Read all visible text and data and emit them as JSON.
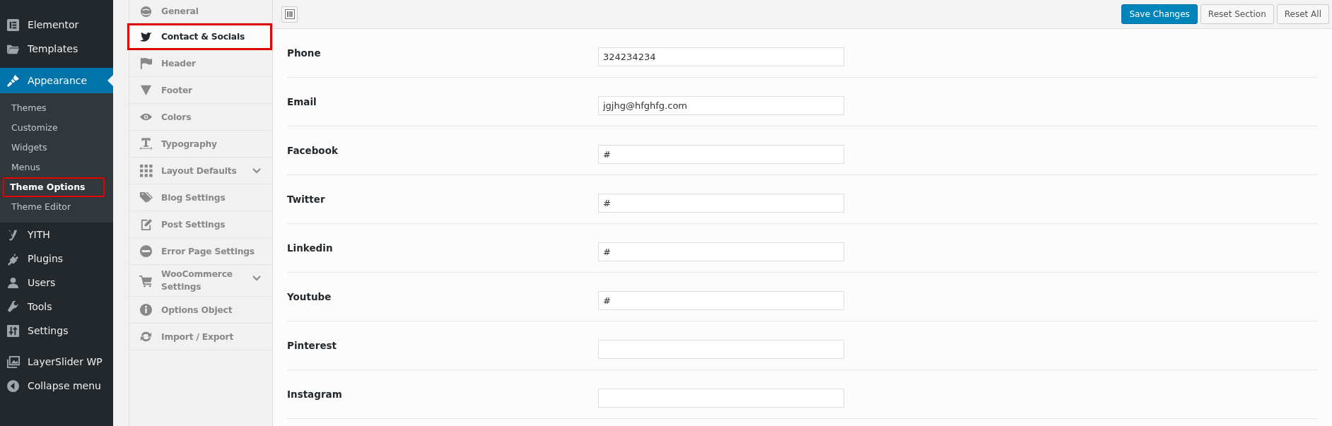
{
  "admin_menu": {
    "groups": [
      {
        "items": [
          {
            "label": "Elementor",
            "current": false
          },
          {
            "label": "Templates",
            "current": false
          }
        ]
      },
      {
        "items": [
          {
            "label": "Appearance",
            "current": true,
            "submenu": [
              {
                "label": "Themes",
                "selected": false,
                "highlighted": false
              },
              {
                "label": "Customize",
                "selected": false,
                "highlighted": false
              },
              {
                "label": "Widgets",
                "selected": false,
                "highlighted": false
              },
              {
                "label": "Menus",
                "selected": false,
                "highlighted": false
              },
              {
                "label": "Theme Options",
                "selected": true,
                "highlighted": true
              },
              {
                "label": "Theme Editor",
                "selected": false,
                "highlighted": false
              }
            ]
          },
          {
            "label": "YITH",
            "current": false
          },
          {
            "label": "Plugins",
            "current": false
          },
          {
            "label": "Users",
            "current": false
          },
          {
            "label": "Tools",
            "current": false
          },
          {
            "label": "Settings",
            "current": false
          }
        ]
      },
      {
        "items": [
          {
            "label": "LayerSlider WP",
            "current": false
          },
          {
            "label": "Collapse menu",
            "current": false
          }
        ]
      }
    ]
  },
  "options_nav": [
    {
      "label": "General",
      "selected": false,
      "highlighted": false,
      "expandable": false
    },
    {
      "label": "Contact & Socials",
      "selected": true,
      "highlighted": true,
      "expandable": false
    },
    {
      "label": "Header",
      "selected": false,
      "highlighted": false,
      "expandable": false
    },
    {
      "label": "Footer",
      "selected": false,
      "highlighted": false,
      "expandable": false
    },
    {
      "label": "Colors",
      "selected": false,
      "highlighted": false,
      "expandable": false
    },
    {
      "label": "Typography",
      "selected": false,
      "highlighted": false,
      "expandable": false
    },
    {
      "label": "Layout Defaults",
      "selected": false,
      "highlighted": false,
      "expandable": true
    },
    {
      "label": "Blog Settings",
      "selected": false,
      "highlighted": false,
      "expandable": false
    },
    {
      "label": "Post Settings",
      "selected": false,
      "highlighted": false,
      "expandable": false
    },
    {
      "label": "Error Page Settings",
      "selected": false,
      "highlighted": false,
      "expandable": false
    },
    {
      "label": "WooCommerce Settings",
      "selected": false,
      "highlighted": false,
      "expandable": true
    },
    {
      "label": "Options Object",
      "selected": false,
      "highlighted": false,
      "expandable": false
    },
    {
      "label": "Import / Export",
      "selected": false,
      "highlighted": false,
      "expandable": false
    }
  ],
  "toolbar": {
    "buttons": [
      {
        "label": "Save Changes",
        "kind": "primary"
      },
      {
        "label": "Reset Section",
        "kind": "secondary"
      },
      {
        "label": "Reset All",
        "kind": "secondary"
      }
    ]
  },
  "fields": [
    {
      "label": "Phone",
      "value": "324234234"
    },
    {
      "label": "Email",
      "value": "jgjhg@hfghfg.com"
    },
    {
      "label": "Facebook",
      "value": "#"
    },
    {
      "label": "Twitter",
      "value": "#"
    },
    {
      "label": "Linkedin",
      "value": "#"
    },
    {
      "label": "Youtube",
      "value": "#"
    },
    {
      "label": "Pinterest"
    },
    {
      "label": "Instagram"
    }
  ]
}
